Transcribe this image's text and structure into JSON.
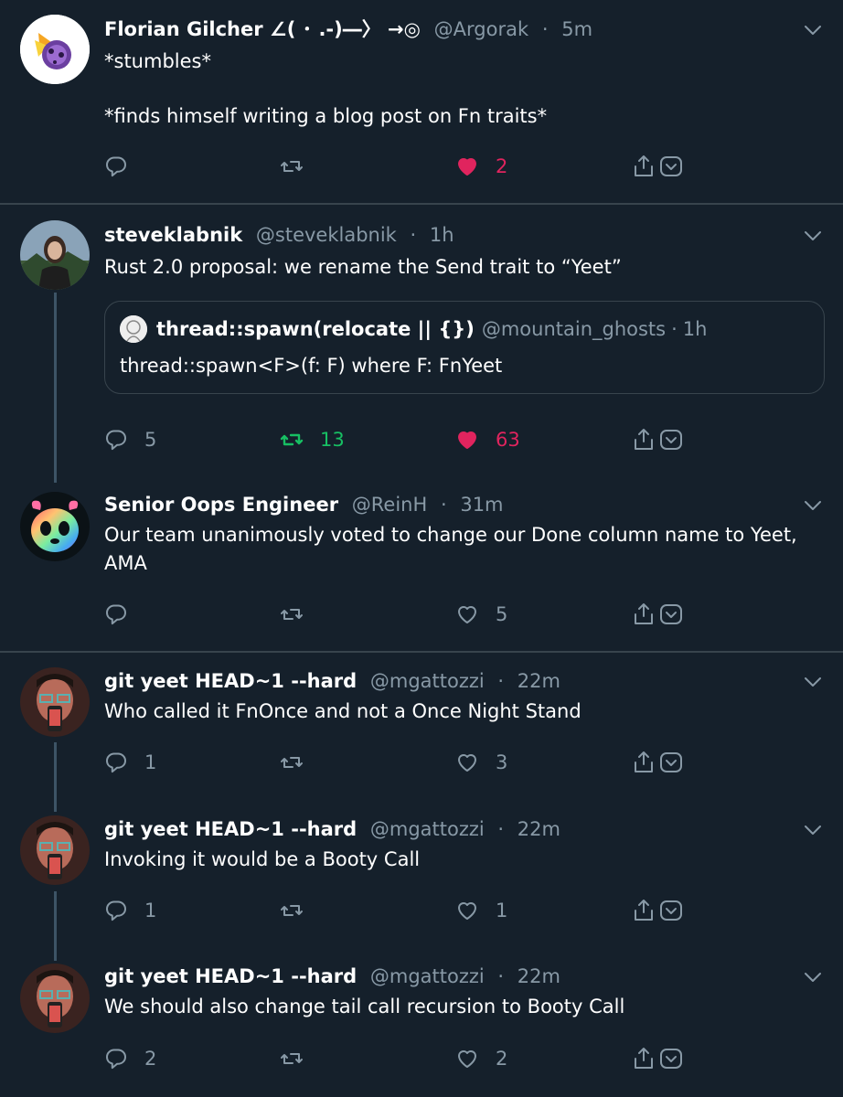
{
  "colors": {
    "background": "#15202b",
    "text": "#ffffff",
    "muted": "#8899a6",
    "like": "#e0245e",
    "retweet": "#17bf63",
    "border": "#38444d"
  },
  "tweets": [
    {
      "name": "Florian Gilcher ∠( ･ .-)―〉 →◎",
      "handle": "@Argorak",
      "time": "5m",
      "lines": [
        "*stumbles*",
        "",
        "*finds himself writing a blog post on Fn traits*"
      ],
      "reply_count": "",
      "retweet_count": "",
      "like_count": "2",
      "liked": true
    },
    {
      "name": "steveklabnik",
      "handle": "@steveklabnik",
      "time": "1h",
      "lines": [
        "Rust 2.0 proposal: we rename the Send trait to “Yeet”"
      ],
      "quote": {
        "name": "thread::spawn(relocate || {})",
        "handle": "@mountain_ghosts",
        "time": "1h",
        "text": "thread::spawn<F>(f: F) where F: FnYeet"
      },
      "reply_count": "5",
      "retweet_count": "13",
      "like_count": "63",
      "liked": true,
      "retweeted": true
    },
    {
      "name": "Senior Oops Engineer",
      "handle": "@ReinH",
      "time": "31m",
      "lines": [
        "Our team unanimously voted to change our Done column name to Yeet,",
        "AMA"
      ],
      "reply_count": "",
      "retweet_count": "",
      "like_count": "5"
    },
    {
      "name": "git yeet HEAD~1 --hard",
      "handle": "@mgattozzi",
      "time": "22m",
      "lines": [
        "Who called it FnOnce and not a Once Night Stand"
      ],
      "reply_count": "1",
      "retweet_count": "",
      "like_count": "3"
    },
    {
      "name": "git yeet HEAD~1 --hard",
      "handle": "@mgattozzi",
      "time": "22m",
      "lines": [
        "Invoking it would be a Booty Call"
      ],
      "reply_count": "1",
      "retweet_count": "",
      "like_count": "1"
    },
    {
      "name": "git yeet HEAD~1 --hard",
      "handle": "@mgattozzi",
      "time": "22m",
      "lines": [
        "We should also change tail call recursion to Booty Call"
      ],
      "reply_count": "2",
      "retweet_count": "",
      "like_count": "2"
    }
  ],
  "separator_dot": "·"
}
